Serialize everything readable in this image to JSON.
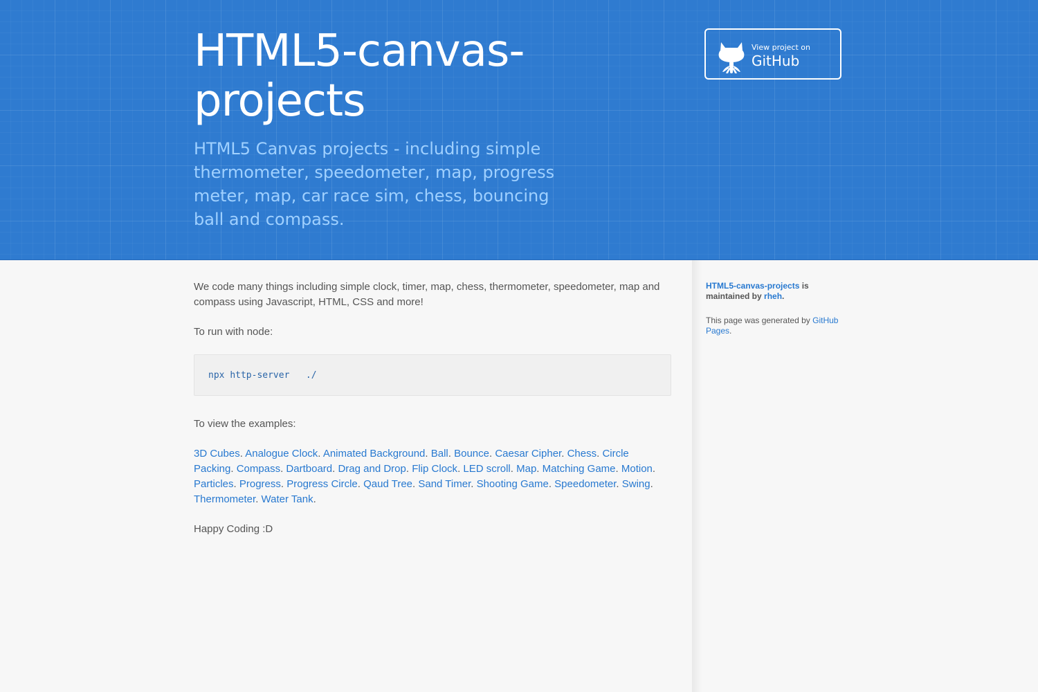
{
  "header": {
    "title": "HTML5-canvas-projects",
    "tagline": "HTML5 Canvas projects - including simple thermometer, speedometer, map, progress meter, map, car race sim, chess, bouncing ball and compass.",
    "github_button": {
      "small_label": "View project on",
      "big_label": "GitHub",
      "icon": "octocat-icon"
    }
  },
  "main": {
    "intro": "We code many things including simple clock, timer, map, chess, thermometer, speedometer, map and compass using Javascript, HTML, CSS and more!",
    "run_label": "To run with node:",
    "code": {
      "cmd": "npx",
      "arg": "http-server",
      "path": "./"
    },
    "view_label": "To view the examples:",
    "examples": [
      "3D Cubes",
      "Analogue Clock",
      "Animated Background",
      "Ball",
      "Bounce",
      "Caesar Cipher",
      "Chess",
      "Circle Packing",
      "Compass",
      "Dartboard",
      "Drag and Drop",
      "Flip Clock",
      "LED scroll",
      "Map",
      "Matching Game",
      "Motion",
      "Particles",
      "Progress",
      "Progress Circle",
      "Qaud Tree",
      "Sand Timer",
      "Shooting Game",
      "Speedometer",
      "Swing",
      "Thermometer",
      "Water Tank"
    ],
    "outro": "Happy Coding :D"
  },
  "sidebar": {
    "project_link": "HTML5-canvas-projects",
    "maintained_text_1": " is maintained by ",
    "maintainer_link": "rheh",
    "period": ".",
    "generated_text": "This page was generated by ",
    "generated_link": "GitHub Pages",
    "generated_period": "."
  },
  "colors": {
    "header_bg": "#2f7bd0",
    "link": "#2879d0",
    "tagline": "#9fd0ff"
  }
}
